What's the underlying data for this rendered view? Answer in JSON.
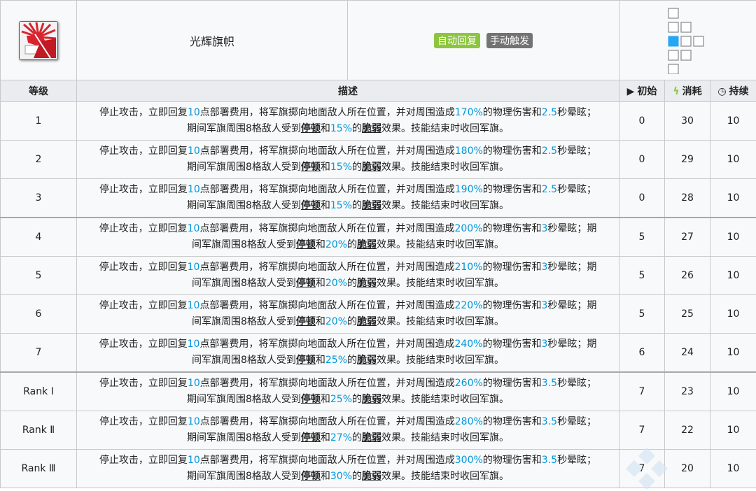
{
  "skill": {
    "name": "光辉旗帜",
    "tags": [
      {
        "label": "自动回复",
        "color": "#8cc63f"
      },
      {
        "label": "手动触发",
        "color": "#737373"
      }
    ],
    "range_grid": [
      [
        0,
        0,
        "cell",
        null,
        null
      ],
      [
        0,
        1,
        "cell",
        null,
        null
      ]
    ]
  },
  "headers": {
    "level": "等级",
    "desc": "描述",
    "init": "初始",
    "cost": "消耗",
    "duration": "持续",
    "init_icon": "play-icon",
    "cost_icon": "lightning-icon",
    "duration_icon": "clock-icon"
  },
  "colors": {
    "highlight": "#0098dc",
    "auto_tag": "#8cc63f",
    "manual_tag": "#737373"
  },
  "rows": [
    {
      "level": "1",
      "p1": "停止攻击，立即回复",
      "v1": "10",
      "p2": "点部署费用，将军旗掷向地面敌人所在位置，并对周围造成",
      "v2": "170%",
      "p3": "的物理伤害和",
      "v3": "2.5",
      "p4": "秒晕眩；",
      "p5": "期间军旗周围8格敌人受到",
      "t1": "停顿",
      "p6": "和",
      "v4": "15%",
      "p7": "的",
      "t2": "脆弱",
      "p8": "效果。技能结束时收回军旗。",
      "init": "0",
      "cost": "30",
      "duration": "10"
    },
    {
      "level": "2",
      "p1": "停止攻击，立即回复",
      "v1": "10",
      "p2": "点部署费用，将军旗掷向地面敌人所在位置，并对周围造成",
      "v2": "180%",
      "p3": "的物理伤害和",
      "v3": "2.5",
      "p4": "秒晕眩；",
      "p5": "期间军旗周围8格敌人受到",
      "t1": "停顿",
      "p6": "和",
      "v4": "15%",
      "p7": "的",
      "t2": "脆弱",
      "p8": "效果。技能结束时收回军旗。",
      "init": "0",
      "cost": "29",
      "duration": "10"
    },
    {
      "level": "3",
      "p1": "停止攻击，立即回复",
      "v1": "10",
      "p2": "点部署费用，将军旗掷向地面敌人所在位置，并对周围造成",
      "v2": "190%",
      "p3": "的物理伤害和",
      "v3": "2.5",
      "p4": "秒晕眩；",
      "p5": "期间军旗周围8格敌人受到",
      "t1": "停顿",
      "p6": "和",
      "v4": "15%",
      "p7": "的",
      "t2": "脆弱",
      "p8": "效果。技能结束时收回军旗。",
      "init": "0",
      "cost": "28",
      "duration": "10"
    },
    {
      "level": "4",
      "p1": "停止攻击，立即回复",
      "v1": "10",
      "p2": "点部署费用，将军旗掷向地面敌人所在位置，并对周围造成",
      "v2": "200%",
      "p3": "的物理伤害和",
      "v3": "3",
      "p4": "秒晕眩；期",
      "p5": "间军旗周围8格敌人受到",
      "t1": "停顿",
      "p6": "和",
      "v4": "20%",
      "p7": "的",
      "t2": "脆弱",
      "p8": "效果。技能结束时收回军旗。",
      "init": "5",
      "cost": "27",
      "duration": "10"
    },
    {
      "level": "5",
      "p1": "停止攻击，立即回复",
      "v1": "10",
      "p2": "点部署费用，将军旗掷向地面敌人所在位置，并对周围造成",
      "v2": "210%",
      "p3": "的物理伤害和",
      "v3": "3",
      "p4": "秒晕眩；期",
      "p5": "间军旗周围8格敌人受到",
      "t1": "停顿",
      "p6": "和",
      "v4": "20%",
      "p7": "的",
      "t2": "脆弱",
      "p8": "效果。技能结束时收回军旗。",
      "init": "5",
      "cost": "26",
      "duration": "10"
    },
    {
      "level": "6",
      "p1": "停止攻击，立即回复",
      "v1": "10",
      "p2": "点部署费用，将军旗掷向地面敌人所在位置，并对周围造成",
      "v2": "220%",
      "p3": "的物理伤害和",
      "v3": "3",
      "p4": "秒晕眩；期",
      "p5": "间军旗周围8格敌人受到",
      "t1": "停顿",
      "p6": "和",
      "v4": "20%",
      "p7": "的",
      "t2": "脆弱",
      "p8": "效果。技能结束时收回军旗。",
      "init": "5",
      "cost": "25",
      "duration": "10"
    },
    {
      "level": "7",
      "p1": "停止攻击，立即回复",
      "v1": "10",
      "p2": "点部署费用，将军旗掷向地面敌人所在位置，并对周围造成",
      "v2": "240%",
      "p3": "的物理伤害和",
      "v3": "3",
      "p4": "秒晕眩；期",
      "p5": "间军旗周围8格敌人受到",
      "t1": "停顿",
      "p6": "和",
      "v4": "25%",
      "p7": "的",
      "t2": "脆弱",
      "p8": "效果。技能结束时收回军旗。",
      "init": "6",
      "cost": "24",
      "duration": "10"
    },
    {
      "level": "Rank Ⅰ",
      "p1": "停止攻击，立即回复",
      "v1": "10",
      "p2": "点部署费用，将军旗掷向地面敌人所在位置，并对周围造成",
      "v2": "260%",
      "p3": "的物理伤害和",
      "v3": "3.5",
      "p4": "秒晕眩；",
      "p5": "期间军旗周围8格敌人受到",
      "t1": "停顿",
      "p6": "和",
      "v4": "25%",
      "p7": "的",
      "t2": "脆弱",
      "p8": "效果。技能结束时收回军旗。",
      "init": "7",
      "cost": "23",
      "duration": "10"
    },
    {
      "level": "Rank Ⅱ",
      "p1": "停止攻击，立即回复",
      "v1": "10",
      "p2": "点部署费用，将军旗掷向地面敌人所在位置，并对周围造成",
      "v2": "280%",
      "p3": "的物理伤害和",
      "v3": "3.5",
      "p4": "秒晕眩；",
      "p5": "期间军旗周围8格敌人受到",
      "t1": "停顿",
      "p6": "和",
      "v4": "27%",
      "p7": "的",
      "t2": "脆弱",
      "p8": "效果。技能结束时收回军旗。",
      "init": "7",
      "cost": "22",
      "duration": "10"
    },
    {
      "level": "Rank Ⅲ",
      "p1": "停止攻击，立即回复",
      "v1": "10",
      "p2": "点部署费用，将军旗掷向地面敌人所在位置，并对周围造成",
      "v2": "300%",
      "p3": "的物理伤害和",
      "v3": "3.5",
      "p4": "秒晕眩；",
      "p5": "期间军旗周围8格敌人受到",
      "t1": "停顿",
      "p6": "和",
      "v4": "30%",
      "p7": "的",
      "t2": "脆弱",
      "p8": "效果。技能结束时收回军旗。",
      "init": "7",
      "cost": "20",
      "duration": "10"
    }
  ]
}
